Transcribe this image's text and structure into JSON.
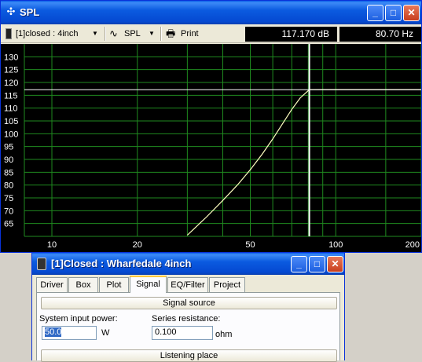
{
  "spl_window": {
    "title": "SPL",
    "toolbar": {
      "project_select": "[1]closed : 4inch",
      "mode_select": "SPL",
      "print_label": "Print",
      "readout_db": "117.170 dB",
      "readout_hz": "80.70 Hz"
    },
    "chart_data": {
      "type": "line",
      "title": "",
      "xlabel": "",
      "ylabel": "",
      "x_scale": "log",
      "xlim": [
        8,
        200
      ],
      "ylim": [
        60,
        135
      ],
      "grid": true,
      "x_ticks": [
        "10",
        "20",
        "50",
        "100",
        "200"
      ],
      "y_ticks": [
        "130",
        "125",
        "120",
        "115",
        "110",
        "105",
        "100",
        "95",
        "90",
        "85",
        "80",
        "75",
        "70",
        "65"
      ],
      "series": [
        {
          "color": "#ffffc0",
          "x": [
            30,
            35,
            40,
            45,
            50,
            55,
            60,
            65,
            70,
            75,
            80.7,
            90,
            100,
            150,
            200
          ],
          "y": [
            60.5,
            67.5,
            74,
            80,
            86,
            92,
            98,
            104,
            109.5,
            114,
            117.17,
            117.2,
            117.2,
            117.2,
            117.2
          ]
        }
      ],
      "cursor": {
        "x": 80.7,
        "y": 117.17
      },
      "colors": {
        "background": "#000000",
        "grid": "#1f8a1f",
        "cursor": "#ffffff",
        "curve": "#ffffc0"
      }
    }
  },
  "closed_window": {
    "title": "[1]Closed : Wharfedale 4inch",
    "tabs": [
      "Driver",
      "Box",
      "Plot",
      "Signal",
      "EQ/Filter",
      "Project"
    ],
    "active_tab": "Signal",
    "signal_source_label": "Signal source",
    "system_input_power_label": "System input power:",
    "system_input_power_value": "50.0",
    "power_unit": "W",
    "series_resistance_label": "Series resistance:",
    "series_resistance_value": "0.100",
    "resistance_unit": "ohm",
    "listening_place_label": "Listening place"
  }
}
